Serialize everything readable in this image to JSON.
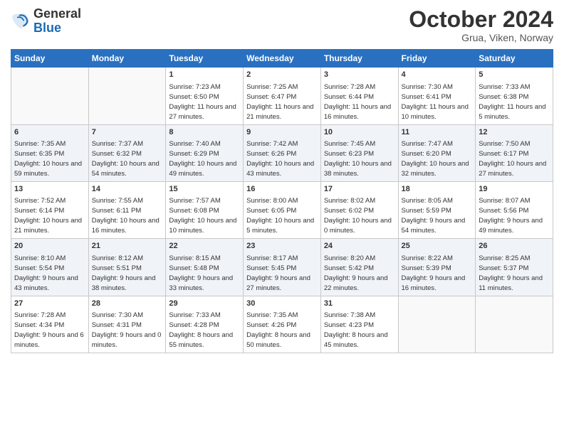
{
  "header": {
    "logo": {
      "general": "General",
      "blue": "Blue"
    },
    "title": "October 2024",
    "location": "Grua, Viken, Norway"
  },
  "weekdays": [
    "Sunday",
    "Monday",
    "Tuesday",
    "Wednesday",
    "Thursday",
    "Friday",
    "Saturday"
  ],
  "weeks": [
    [
      {
        "day": "",
        "sunrise": "",
        "sunset": "",
        "daylight": "",
        "empty": true
      },
      {
        "day": "",
        "sunrise": "",
        "sunset": "",
        "daylight": "",
        "empty": true
      },
      {
        "day": "1",
        "sunrise": "Sunrise: 7:23 AM",
        "sunset": "Sunset: 6:50 PM",
        "daylight": "Daylight: 11 hours and 27 minutes.",
        "empty": false
      },
      {
        "day": "2",
        "sunrise": "Sunrise: 7:25 AM",
        "sunset": "Sunset: 6:47 PM",
        "daylight": "Daylight: 11 hours and 21 minutes.",
        "empty": false
      },
      {
        "day": "3",
        "sunrise": "Sunrise: 7:28 AM",
        "sunset": "Sunset: 6:44 PM",
        "daylight": "Daylight: 11 hours and 16 minutes.",
        "empty": false
      },
      {
        "day": "4",
        "sunrise": "Sunrise: 7:30 AM",
        "sunset": "Sunset: 6:41 PM",
        "daylight": "Daylight: 11 hours and 10 minutes.",
        "empty": false
      },
      {
        "day": "5",
        "sunrise": "Sunrise: 7:33 AM",
        "sunset": "Sunset: 6:38 PM",
        "daylight": "Daylight: 11 hours and 5 minutes.",
        "empty": false
      }
    ],
    [
      {
        "day": "6",
        "sunrise": "Sunrise: 7:35 AM",
        "sunset": "Sunset: 6:35 PM",
        "daylight": "Daylight: 10 hours and 59 minutes.",
        "empty": false
      },
      {
        "day": "7",
        "sunrise": "Sunrise: 7:37 AM",
        "sunset": "Sunset: 6:32 PM",
        "daylight": "Daylight: 10 hours and 54 minutes.",
        "empty": false
      },
      {
        "day": "8",
        "sunrise": "Sunrise: 7:40 AM",
        "sunset": "Sunset: 6:29 PM",
        "daylight": "Daylight: 10 hours and 49 minutes.",
        "empty": false
      },
      {
        "day": "9",
        "sunrise": "Sunrise: 7:42 AM",
        "sunset": "Sunset: 6:26 PM",
        "daylight": "Daylight: 10 hours and 43 minutes.",
        "empty": false
      },
      {
        "day": "10",
        "sunrise": "Sunrise: 7:45 AM",
        "sunset": "Sunset: 6:23 PM",
        "daylight": "Daylight: 10 hours and 38 minutes.",
        "empty": false
      },
      {
        "day": "11",
        "sunrise": "Sunrise: 7:47 AM",
        "sunset": "Sunset: 6:20 PM",
        "daylight": "Daylight: 10 hours and 32 minutes.",
        "empty": false
      },
      {
        "day": "12",
        "sunrise": "Sunrise: 7:50 AM",
        "sunset": "Sunset: 6:17 PM",
        "daylight": "Daylight: 10 hours and 27 minutes.",
        "empty": false
      }
    ],
    [
      {
        "day": "13",
        "sunrise": "Sunrise: 7:52 AM",
        "sunset": "Sunset: 6:14 PM",
        "daylight": "Daylight: 10 hours and 21 minutes.",
        "empty": false
      },
      {
        "day": "14",
        "sunrise": "Sunrise: 7:55 AM",
        "sunset": "Sunset: 6:11 PM",
        "daylight": "Daylight: 10 hours and 16 minutes.",
        "empty": false
      },
      {
        "day": "15",
        "sunrise": "Sunrise: 7:57 AM",
        "sunset": "Sunset: 6:08 PM",
        "daylight": "Daylight: 10 hours and 10 minutes.",
        "empty": false
      },
      {
        "day": "16",
        "sunrise": "Sunrise: 8:00 AM",
        "sunset": "Sunset: 6:05 PM",
        "daylight": "Daylight: 10 hours and 5 minutes.",
        "empty": false
      },
      {
        "day": "17",
        "sunrise": "Sunrise: 8:02 AM",
        "sunset": "Sunset: 6:02 PM",
        "daylight": "Daylight: 10 hours and 0 minutes.",
        "empty": false
      },
      {
        "day": "18",
        "sunrise": "Sunrise: 8:05 AM",
        "sunset": "Sunset: 5:59 PM",
        "daylight": "Daylight: 9 hours and 54 minutes.",
        "empty": false
      },
      {
        "day": "19",
        "sunrise": "Sunrise: 8:07 AM",
        "sunset": "Sunset: 5:56 PM",
        "daylight": "Daylight: 9 hours and 49 minutes.",
        "empty": false
      }
    ],
    [
      {
        "day": "20",
        "sunrise": "Sunrise: 8:10 AM",
        "sunset": "Sunset: 5:54 PM",
        "daylight": "Daylight: 9 hours and 43 minutes.",
        "empty": false
      },
      {
        "day": "21",
        "sunrise": "Sunrise: 8:12 AM",
        "sunset": "Sunset: 5:51 PM",
        "daylight": "Daylight: 9 hours and 38 minutes.",
        "empty": false
      },
      {
        "day": "22",
        "sunrise": "Sunrise: 8:15 AM",
        "sunset": "Sunset: 5:48 PM",
        "daylight": "Daylight: 9 hours and 33 minutes.",
        "empty": false
      },
      {
        "day": "23",
        "sunrise": "Sunrise: 8:17 AM",
        "sunset": "Sunset: 5:45 PM",
        "daylight": "Daylight: 9 hours and 27 minutes.",
        "empty": false
      },
      {
        "day": "24",
        "sunrise": "Sunrise: 8:20 AM",
        "sunset": "Sunset: 5:42 PM",
        "daylight": "Daylight: 9 hours and 22 minutes.",
        "empty": false
      },
      {
        "day": "25",
        "sunrise": "Sunrise: 8:22 AM",
        "sunset": "Sunset: 5:39 PM",
        "daylight": "Daylight: 9 hours and 16 minutes.",
        "empty": false
      },
      {
        "day": "26",
        "sunrise": "Sunrise: 8:25 AM",
        "sunset": "Sunset: 5:37 PM",
        "daylight": "Daylight: 9 hours and 11 minutes.",
        "empty": false
      }
    ],
    [
      {
        "day": "27",
        "sunrise": "Sunrise: 7:28 AM",
        "sunset": "Sunset: 4:34 PM",
        "daylight": "Daylight: 9 hours and 6 minutes.",
        "empty": false
      },
      {
        "day": "28",
        "sunrise": "Sunrise: 7:30 AM",
        "sunset": "Sunset: 4:31 PM",
        "daylight": "Daylight: 9 hours and 0 minutes.",
        "empty": false
      },
      {
        "day": "29",
        "sunrise": "Sunrise: 7:33 AM",
        "sunset": "Sunset: 4:28 PM",
        "daylight": "Daylight: 8 hours and 55 minutes.",
        "empty": false
      },
      {
        "day": "30",
        "sunrise": "Sunrise: 7:35 AM",
        "sunset": "Sunset: 4:26 PM",
        "daylight": "Daylight: 8 hours and 50 minutes.",
        "empty": false
      },
      {
        "day": "31",
        "sunrise": "Sunrise: 7:38 AM",
        "sunset": "Sunset: 4:23 PM",
        "daylight": "Daylight: 8 hours and 45 minutes.",
        "empty": false
      },
      {
        "day": "",
        "sunrise": "",
        "sunset": "",
        "daylight": "",
        "empty": true
      },
      {
        "day": "",
        "sunrise": "",
        "sunset": "",
        "daylight": "",
        "empty": true
      }
    ]
  ]
}
